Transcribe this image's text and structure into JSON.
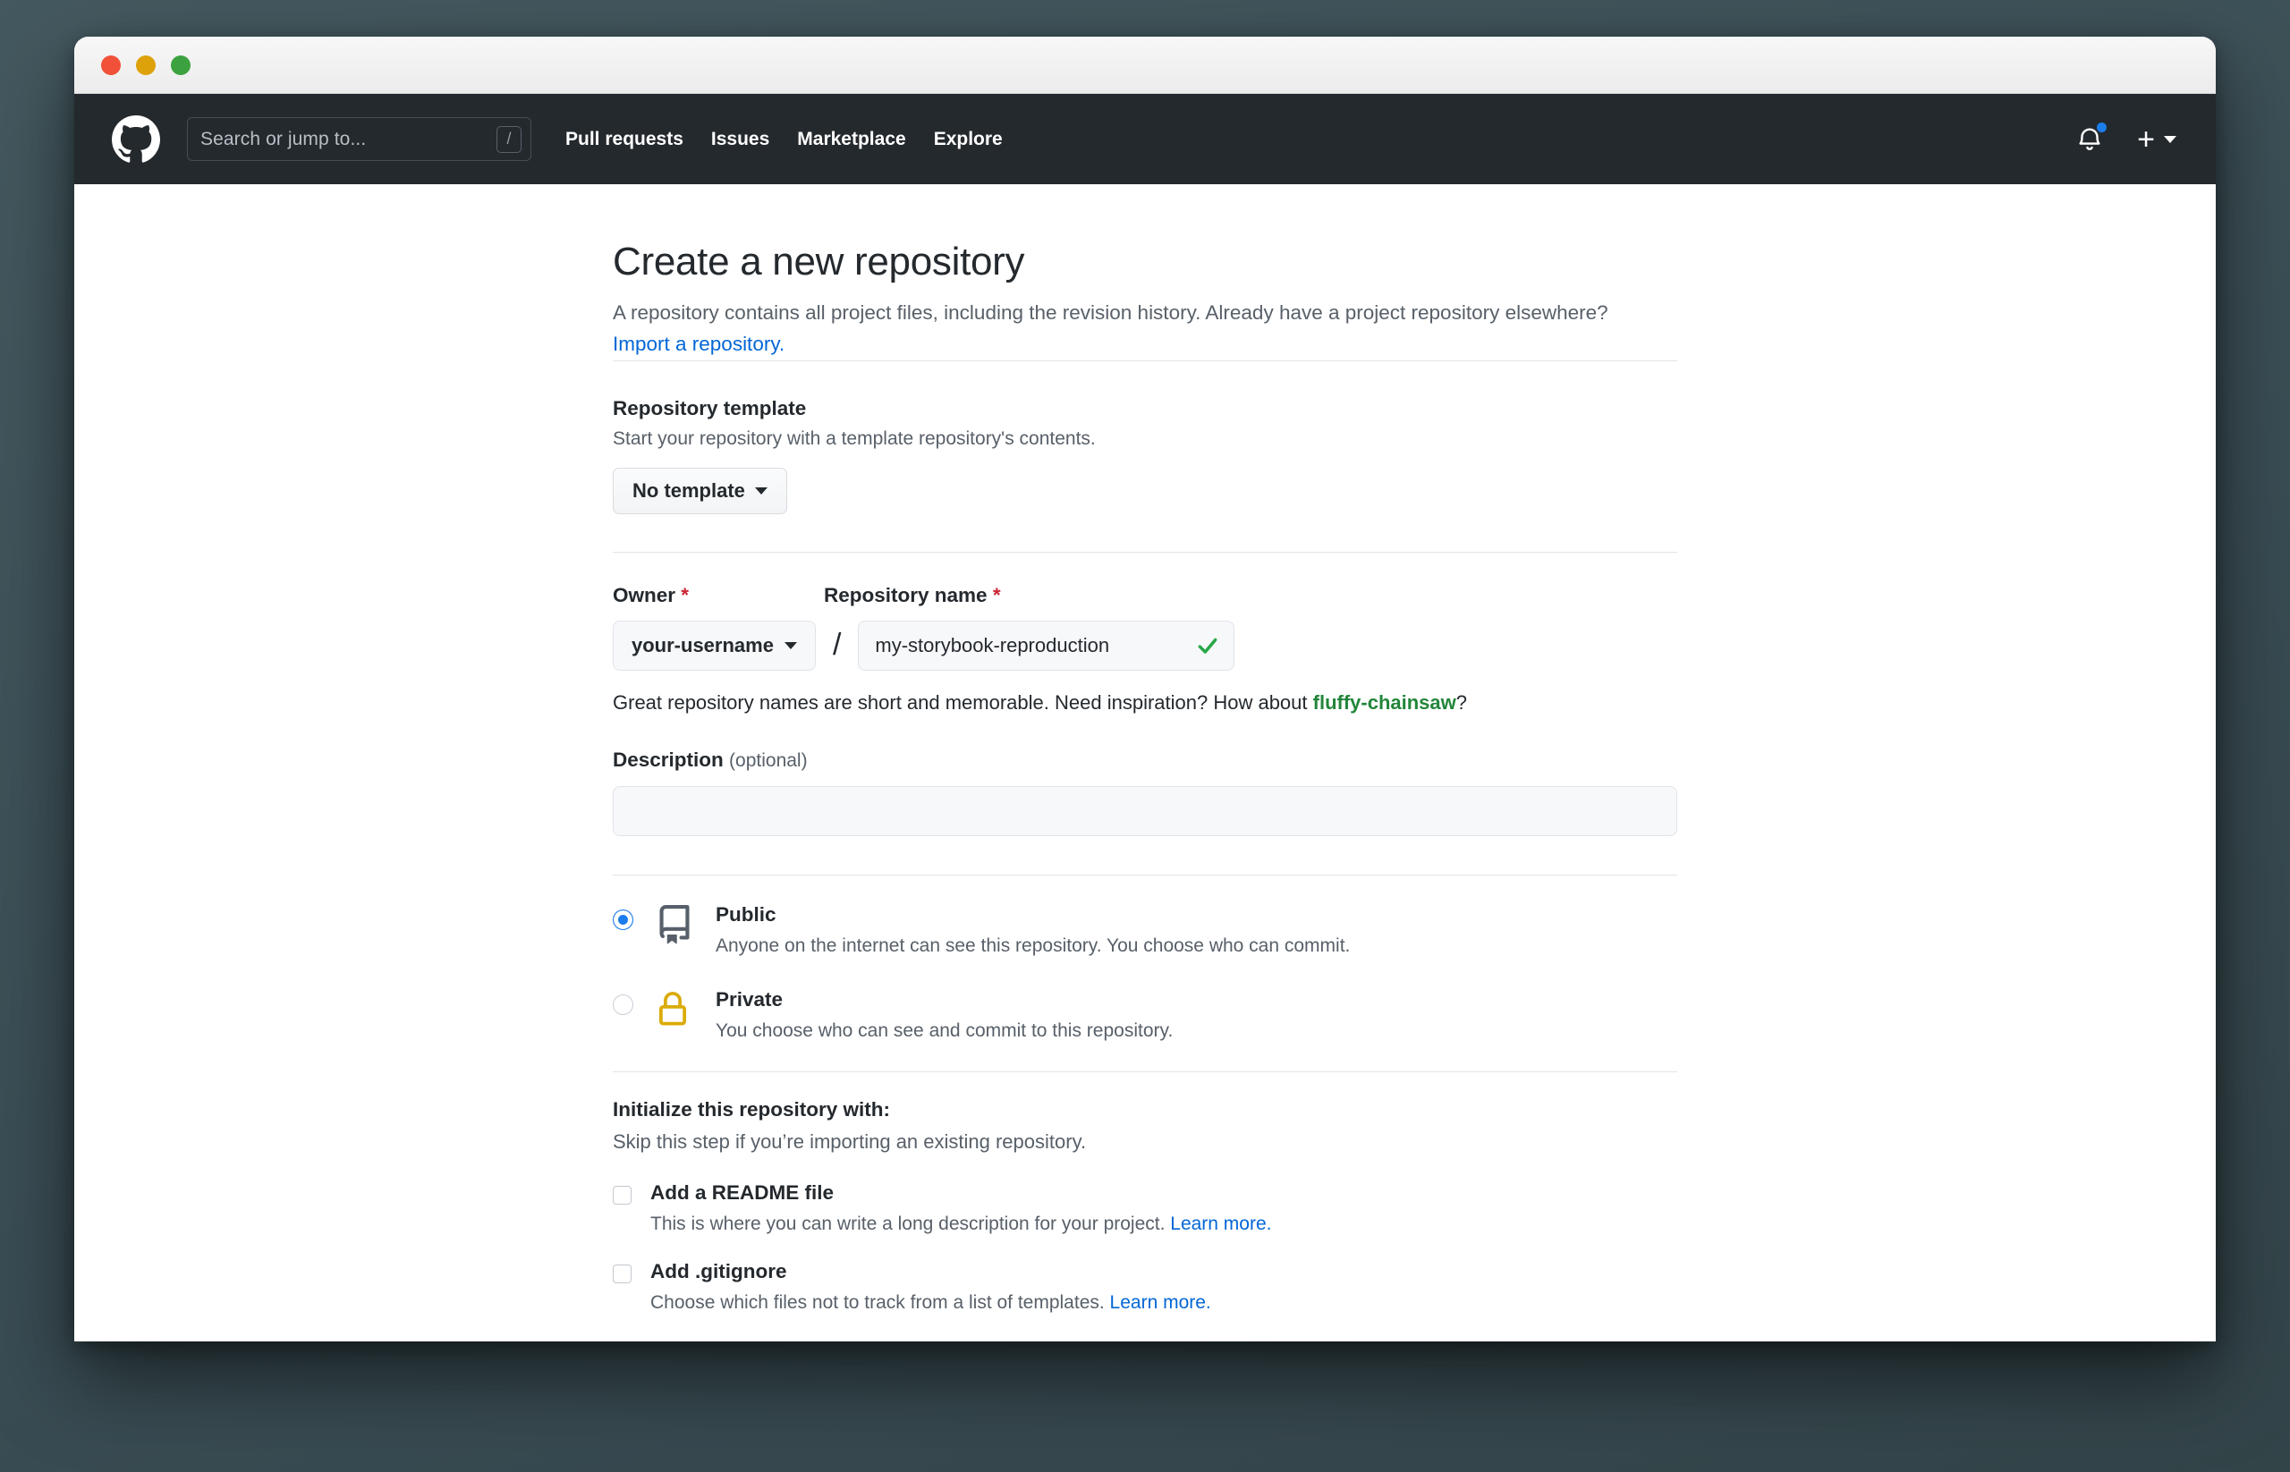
{
  "window": {
    "traffic_lights": [
      "close",
      "minimize",
      "zoom"
    ]
  },
  "header": {
    "logo": "github-logo-icon",
    "search": {
      "placeholder": "Search or jump to...",
      "shortcut_key": "/"
    },
    "nav": [
      {
        "label": "Pull requests"
      },
      {
        "label": "Issues"
      },
      {
        "label": "Marketplace"
      },
      {
        "label": "Explore"
      }
    ],
    "notifications_icon": "bell-icon",
    "has_unread": true,
    "create_new_icon": "plus-icon",
    "bg_color": "#24292e"
  },
  "main": {
    "title": "Create a new repository",
    "lede_part1": "A repository contains all project files, including the revision history. Already have a project repository elsewhere? ",
    "lede_link": "Import a repository.",
    "template": {
      "label": "Repository template",
      "description": "Start your repository with a template repository's contents.",
      "button_label": "No template"
    },
    "owner": {
      "label": "Owner",
      "required_mark": "*",
      "value": "your-username"
    },
    "separator": "/",
    "repo_name": {
      "label": "Repository name",
      "required_mark": "*",
      "value": "my-storybook-reproduction",
      "valid_icon": "check-icon"
    },
    "name_hint_part1": "Great repository names are short and memorable. Need inspiration? How about ",
    "name_hint_suggestion": "fluffy-chainsaw",
    "name_hint_part2": "?",
    "description": {
      "label": "Description",
      "optional_label": "(optional)",
      "value": "",
      "placeholder": ""
    },
    "visibility": [
      {
        "id": "public",
        "name": "Public",
        "description": "Anyone on the internet can see this repository. You choose who can commit.",
        "icon": "repo-icon",
        "icon_color": "#57606a",
        "selected": true
      },
      {
        "id": "private",
        "name": "Private",
        "description": "You choose who can see and commit to this repository.",
        "icon": "lock-icon",
        "icon_color": "#dbab09",
        "selected": false
      }
    ],
    "initialize": {
      "title": "Initialize this repository with:",
      "subtitle": "Skip this step if you’re importing an existing repository.",
      "options": [
        {
          "name": "Add a README file",
          "description": "This is where you can write a long description for your project. ",
          "link": "Learn more.",
          "checked": false
        },
        {
          "name": "Add .gitignore",
          "description": "Choose which files not to track from a list of templates. ",
          "link": "Learn more.",
          "checked": false
        }
      ]
    }
  },
  "colors": {
    "accent_blue": "#0366d6",
    "success_green": "#22863a",
    "required_red": "#cb2431",
    "header_bg": "#24292e",
    "lock_amber": "#dbab09"
  }
}
